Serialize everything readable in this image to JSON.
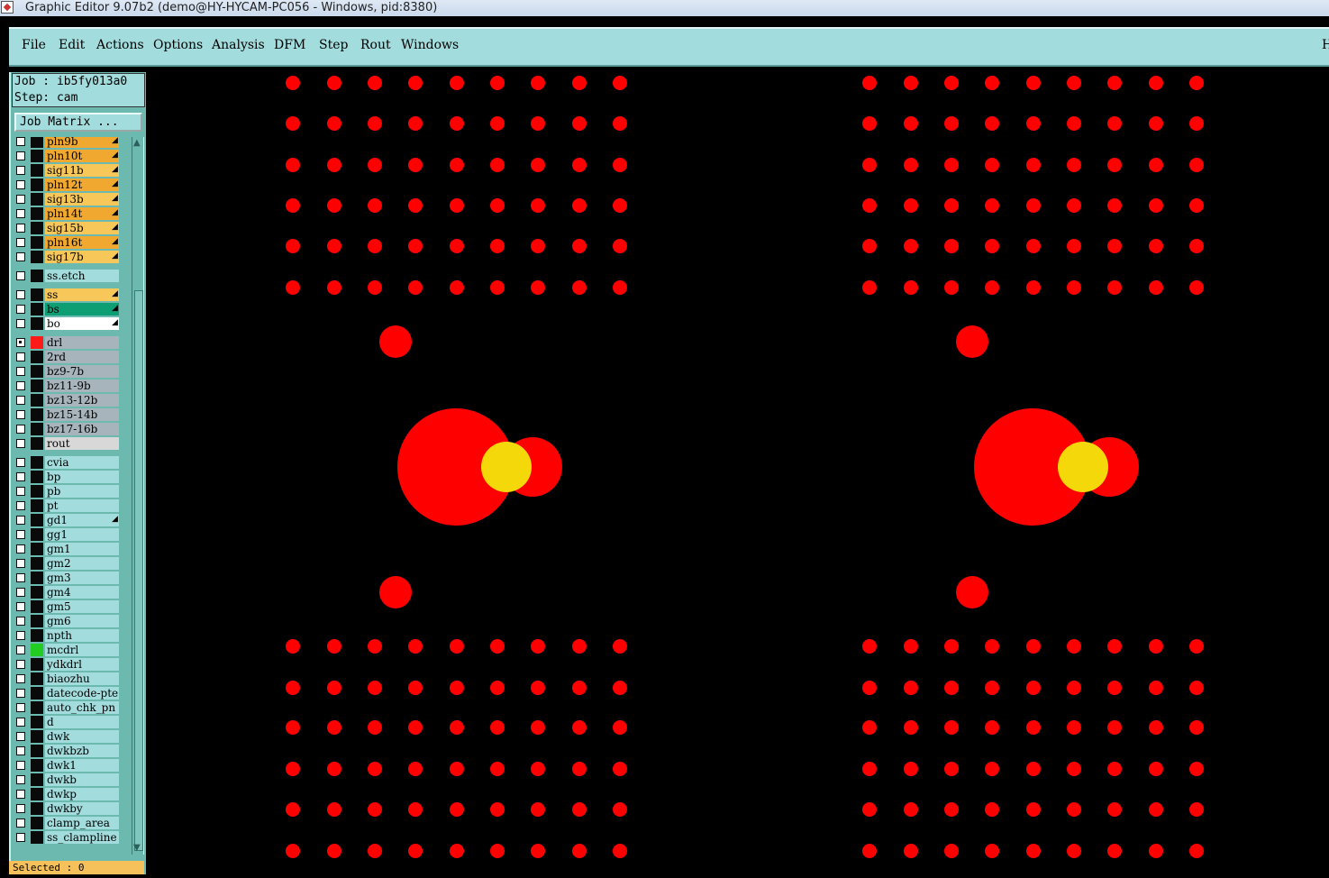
{
  "window": {
    "title": "Graphic Editor 9.07b2 (demo@HY-HYCAM-PC056 - Windows, pid:8380)"
  },
  "menu": [
    "File",
    "Edit",
    "Actions",
    "Options",
    "Analysis",
    "DFM",
    "Step",
    "Rout",
    "Windows"
  ],
  "menu_right_label": "H",
  "job": {
    "job_line": "Job : ib5fy013a0",
    "step_line": "Step: cam"
  },
  "job_matrix_button": "Job Matrix ...",
  "layers": [
    {
      "name": "pln9b",
      "bg": "#f0a830",
      "arrow": true
    },
    {
      "name": "pln10t",
      "bg": "#f0a830",
      "arrow": true
    },
    {
      "name": "sig11b",
      "bg": "#f7c75a",
      "arrow": true
    },
    {
      "name": "pln12t",
      "bg": "#f0a830",
      "arrow": true
    },
    {
      "name": "sig13b",
      "bg": "#f7c75a",
      "arrow": true
    },
    {
      "name": "pln14t",
      "bg": "#f0a830",
      "arrow": true
    },
    {
      "name": "sig15b",
      "bg": "#f7c75a",
      "arrow": true
    },
    {
      "name": "pln16t",
      "bg": "#f0a830",
      "arrow": true
    },
    {
      "name": "sig17b",
      "bg": "#f7c75a",
      "arrow": true
    },
    {
      "name": "ss.etch",
      "bg": "#a3dcdc",
      "arrow": false
    },
    {
      "name": "ss",
      "bg": "#f7c75a",
      "arrow": true
    },
    {
      "name": "bs",
      "bg": "#0d9e74",
      "arrow": true
    },
    {
      "name": "bo",
      "bg": "#ffffff",
      "arrow": true
    },
    {
      "name": "drl",
      "bg": "#a8b4bc",
      "arrow": false,
      "checked": true,
      "swatch": "#ff1a1a"
    },
    {
      "name": "2rd",
      "bg": "#a8b4bc",
      "arrow": false
    },
    {
      "name": "bz9-7b",
      "bg": "#a8b4bc",
      "arrow": false
    },
    {
      "name": "bz11-9b",
      "bg": "#a8b4bc",
      "arrow": false
    },
    {
      "name": "bz13-12b",
      "bg": "#a8b4bc",
      "arrow": false
    },
    {
      "name": "bz15-14b",
      "bg": "#a8b4bc",
      "arrow": false
    },
    {
      "name": "bz17-16b",
      "bg": "#a8b4bc",
      "arrow": false
    },
    {
      "name": "rout",
      "bg": "#d8d8d8",
      "arrow": false
    },
    {
      "name": "cvia",
      "bg": "#a3dcdc",
      "arrow": false
    },
    {
      "name": "bp",
      "bg": "#a3dcdc",
      "arrow": false
    },
    {
      "name": "pb",
      "bg": "#a3dcdc",
      "arrow": false
    },
    {
      "name": "pt",
      "bg": "#a3dcdc",
      "arrow": false
    },
    {
      "name": "gd1",
      "bg": "#a3dcdc",
      "arrow": true
    },
    {
      "name": "gg1",
      "bg": "#a3dcdc",
      "arrow": false
    },
    {
      "name": "gm1",
      "bg": "#a3dcdc",
      "arrow": false
    },
    {
      "name": "gm2",
      "bg": "#a3dcdc",
      "arrow": false
    },
    {
      "name": "gm3",
      "bg": "#a3dcdc",
      "arrow": false
    },
    {
      "name": "gm4",
      "bg": "#a3dcdc",
      "arrow": false
    },
    {
      "name": "gm5",
      "bg": "#a3dcdc",
      "arrow": false
    },
    {
      "name": "gm6",
      "bg": "#a3dcdc",
      "arrow": false
    },
    {
      "name": "npth",
      "bg": "#a3dcdc",
      "arrow": false
    },
    {
      "name": "mcdrl",
      "bg": "#a3dcdc",
      "arrow": false,
      "swatch": "#22cc22"
    },
    {
      "name": "ydkdrl",
      "bg": "#a3dcdc",
      "arrow": false
    },
    {
      "name": "biaozhu",
      "bg": "#a3dcdc",
      "arrow": false
    },
    {
      "name": "datecode-pte",
      "bg": "#a3dcdc",
      "arrow": false
    },
    {
      "name": "auto_chk_pn",
      "bg": "#a3dcdc",
      "arrow": false
    },
    {
      "name": "d",
      "bg": "#a3dcdc",
      "arrow": false
    },
    {
      "name": "dwk",
      "bg": "#a3dcdc",
      "arrow": false
    },
    {
      "name": "dwkbzb",
      "bg": "#a3dcdc",
      "arrow": false
    },
    {
      "name": "dwk1",
      "bg": "#a3dcdc",
      "arrow": false
    },
    {
      "name": "dwkb",
      "bg": "#a3dcdc",
      "arrow": false
    },
    {
      "name": "dwkp",
      "bg": "#a3dcdc",
      "arrow": false
    },
    {
      "name": "dwkby",
      "bg": "#a3dcdc",
      "arrow": false
    },
    {
      "name": "clamp_area",
      "bg": "#a3dcdc",
      "arrow": false
    },
    {
      "name": "ss_clampline",
      "bg": "#a3dcdc",
      "arrow": false
    }
  ],
  "status": {
    "selected": "Selected : 0"
  },
  "canvas": {
    "background": "#000000",
    "pad_color": "#ff0000",
    "highlight_color": "#f5d80a"
  }
}
